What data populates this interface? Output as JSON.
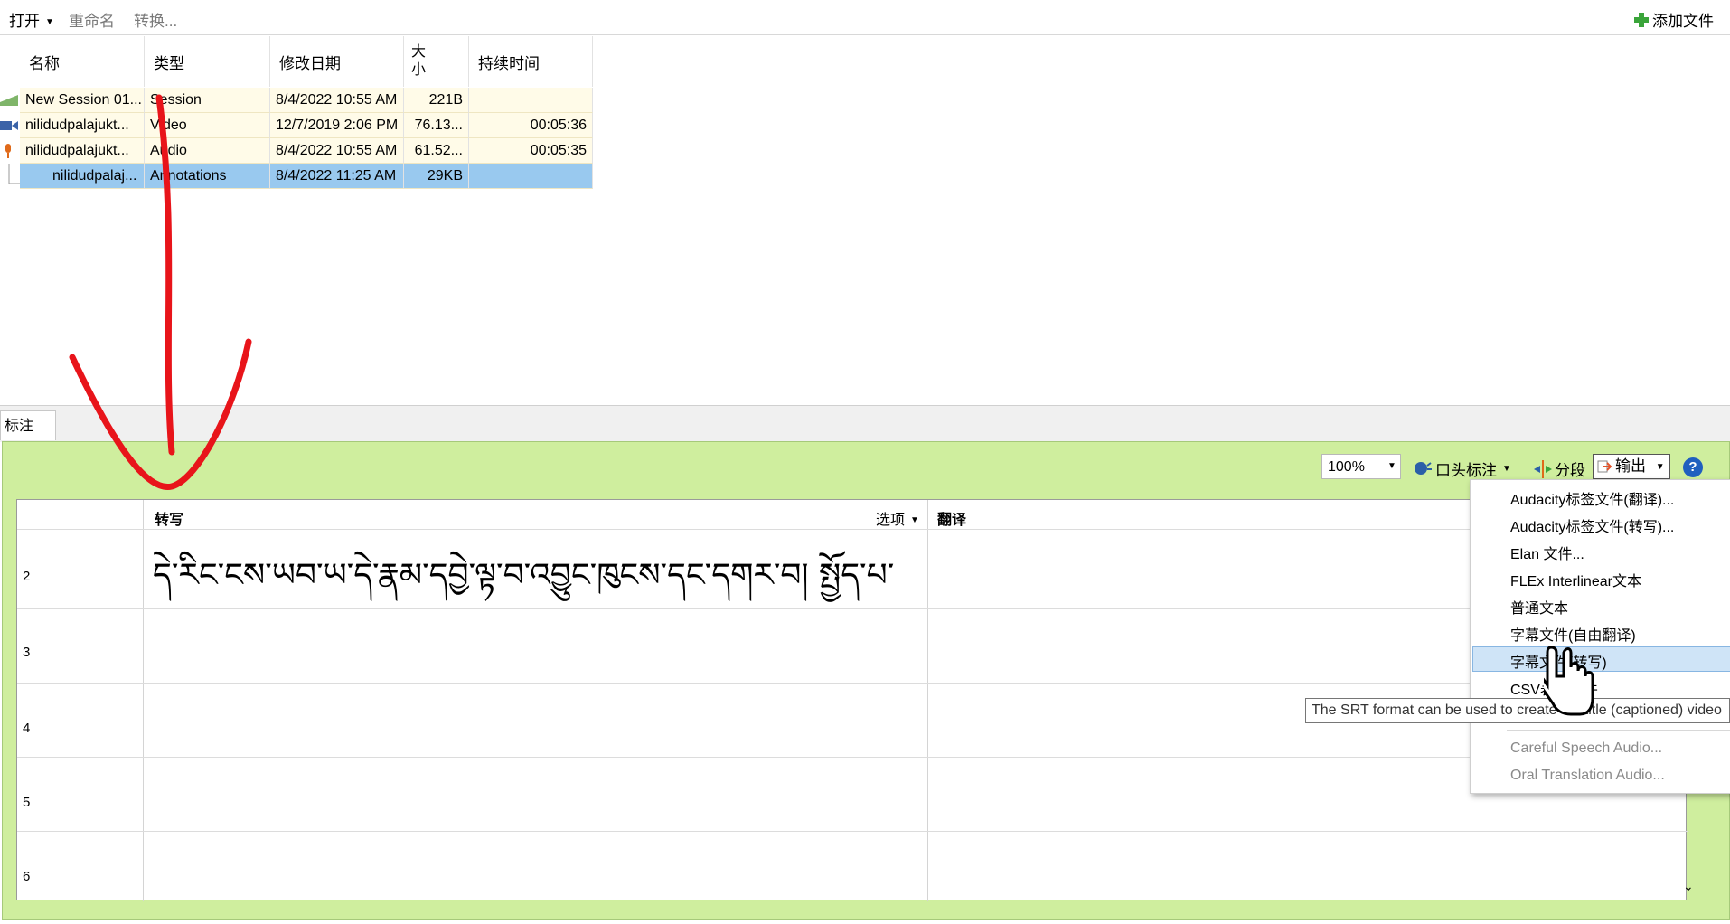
{
  "toolbar": {
    "open_label": "打开",
    "rename_label": "重命名",
    "convert_label": "转换...",
    "add_file_label": "添加文件"
  },
  "files": {
    "columns": [
      "名称",
      "类型",
      "修改日期",
      "大小",
      "持续时间"
    ],
    "rows": [
      {
        "name": "New Session 01...",
        "type": "Session",
        "modified": "8/4/2022 10:55 AM",
        "size": "221B",
        "duration": ""
      },
      {
        "name": "nilidudpalajukt...",
        "type": "Video",
        "modified": "12/7/2019 2:06 PM",
        "size": "76.13...",
        "duration": "00:05:36"
      },
      {
        "name": "nilidudpalajukt...",
        "type": "Audio",
        "modified": "8/4/2022 10:55 AM",
        "size": "61.52...",
        "duration": "00:05:35"
      },
      {
        "name": "nilidudpalaj...",
        "type": "Annotations",
        "modified": "8/4/2022 11:25 AM",
        "size": "29KB",
        "duration": ""
      }
    ]
  },
  "tabs": {
    "annotation_label": "标注"
  },
  "annot_toolbar": {
    "zoom_value": "100%",
    "oral_label": "口头标注",
    "segment_label": "分段",
    "export_label": "输出",
    "help_symbol": "?"
  },
  "grid": {
    "transcription_header": "转写",
    "options_label": "选项",
    "translation_header": "翻译",
    "rows": [
      {
        "num": "2",
        "text": "དེ་རིང་ངས་ཡབ་ཡ་དེ་རྣམ་དབྱེ་ལྟ་བ་འབྱུང་ཁུངས་དང་དགར་བ། སྤྱོད་པ་"
      },
      {
        "num": "3",
        "text": ""
      },
      {
        "num": "4",
        "text": ""
      },
      {
        "num": "5",
        "text": ""
      },
      {
        "num": "6",
        "text": ""
      }
    ]
  },
  "export_menu": {
    "items": [
      "Audacity标签文件(翻译)...",
      "Audacity标签文件(转写)...",
      "Elan 文件...",
      "FLEx Interlinear文本",
      "普通文本",
      "字幕文件(自由翻译)",
      "字幕文件(转写)",
      "CSV表格文件"
    ],
    "disabled_items": [
      "Careful Speech Audio...",
      "Oral Translation Audio..."
    ],
    "tooltip": "The SRT format can be used to create subtitle (captioned) video"
  },
  "colors": {
    "panel_green": "#cfee9e",
    "selected_row": "#99c9ef",
    "arrow_red": "#e8141a"
  }
}
